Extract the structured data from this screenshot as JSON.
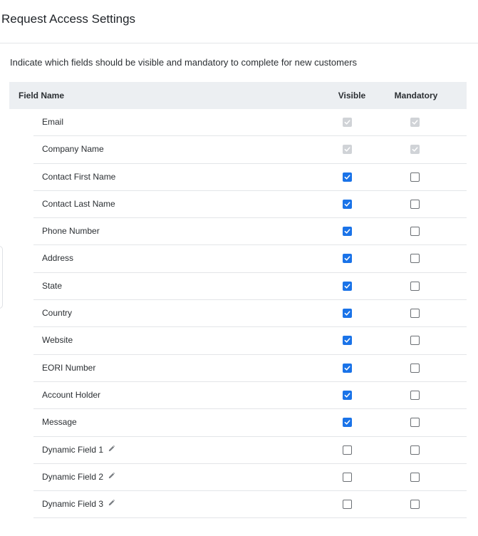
{
  "page": {
    "title": "Request Access Settings",
    "description": "Indicate which fields should be visible and mandatory to complete for new customers"
  },
  "table": {
    "headers": {
      "field_name": "Field Name",
      "visible": "Visible",
      "mandatory": "Mandatory"
    },
    "rows": [
      {
        "label": "Email",
        "visible": true,
        "mandatory": true,
        "locked": true,
        "editable": false
      },
      {
        "label": "Company Name",
        "visible": true,
        "mandatory": true,
        "locked": true,
        "editable": false
      },
      {
        "label": "Contact First Name",
        "visible": true,
        "mandatory": false,
        "locked": false,
        "editable": false
      },
      {
        "label": "Contact Last Name",
        "visible": true,
        "mandatory": false,
        "locked": false,
        "editable": false
      },
      {
        "label": "Phone Number",
        "visible": true,
        "mandatory": false,
        "locked": false,
        "editable": false
      },
      {
        "label": "Address",
        "visible": true,
        "mandatory": false,
        "locked": false,
        "editable": false
      },
      {
        "label": "State",
        "visible": true,
        "mandatory": false,
        "locked": false,
        "editable": false
      },
      {
        "label": "Country",
        "visible": true,
        "mandatory": false,
        "locked": false,
        "editable": false
      },
      {
        "label": "Website",
        "visible": true,
        "mandatory": false,
        "locked": false,
        "editable": false
      },
      {
        "label": "EORI Number",
        "visible": true,
        "mandatory": false,
        "locked": false,
        "editable": false
      },
      {
        "label": "Account Holder",
        "visible": true,
        "mandatory": false,
        "locked": false,
        "editable": false
      },
      {
        "label": "Message",
        "visible": true,
        "mandatory": false,
        "locked": false,
        "editable": false
      },
      {
        "label": "Dynamic Field 1",
        "visible": false,
        "mandatory": false,
        "locked": false,
        "editable": true
      },
      {
        "label": "Dynamic Field 2",
        "visible": false,
        "mandatory": false,
        "locked": false,
        "editable": true
      },
      {
        "label": "Dynamic Field 3",
        "visible": false,
        "mandatory": false,
        "locked": false,
        "editable": true
      }
    ]
  },
  "icons": {
    "edit": "pencil-icon",
    "check": "check-icon"
  },
  "colors": {
    "accent": "#1a73e8",
    "disabled_check": "#d0d3d7",
    "header_bg": "#eceff2",
    "divider": "#e3e5e8"
  }
}
